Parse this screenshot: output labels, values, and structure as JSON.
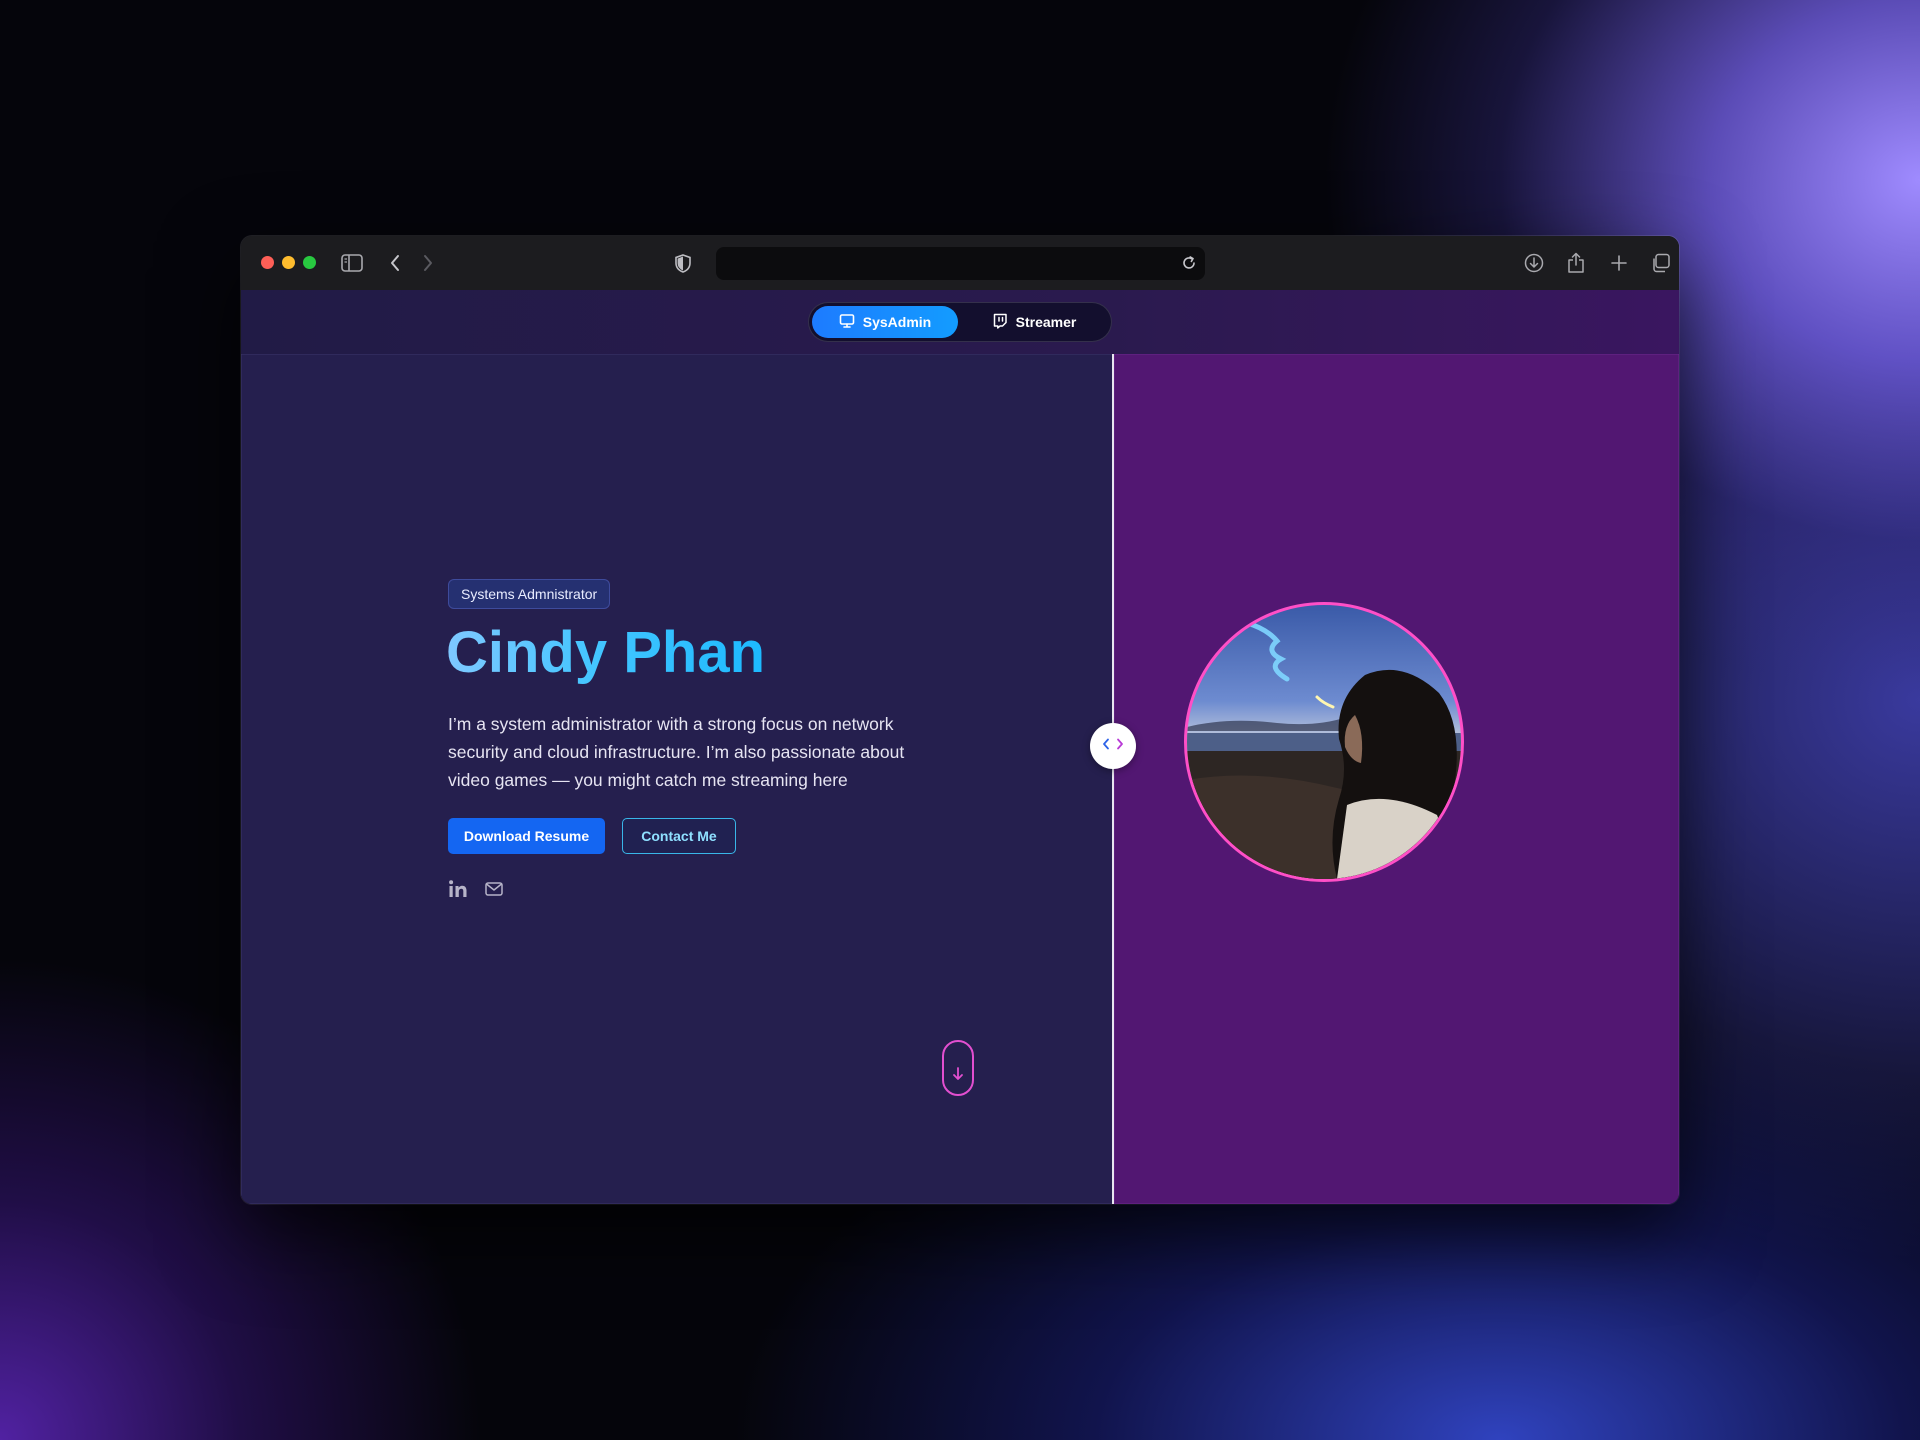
{
  "browser": {
    "url": "",
    "colors": {
      "close": "#fe5f57",
      "minimize": "#febc2e",
      "zoom": "#28c840"
    },
    "icons": [
      "sidebar-icon",
      "back-icon",
      "forward-icon",
      "shield-icon",
      "reload-icon",
      "download-icon",
      "share-icon",
      "new-tab-icon",
      "tabs-overview-icon"
    ]
  },
  "nav": {
    "toggle": [
      {
        "label": "SysAdmin",
        "icon": "monitor-icon",
        "active": true
      },
      {
        "label": "Streamer",
        "icon": "twitch-icon",
        "active": false
      }
    ]
  },
  "hero": {
    "badge": "Systems Admnistrator",
    "name": "Cindy Phan",
    "bio": "I’m a system administrator with a strong focus on network security and cloud infrastructure. I’m also passionate about video games — you might catch me streaming here",
    "buttons": {
      "primary": "Download Resume",
      "secondary": "Contact Me"
    },
    "social": [
      "linkedin-icon",
      "mail-icon"
    ]
  },
  "theme": {
    "accent_blue": "#1466f2",
    "accent_cyan": "#39b6e8",
    "accent_pink": "#ff4fc7",
    "left_bg": "#251f4e",
    "right_bg": "#521772"
  }
}
